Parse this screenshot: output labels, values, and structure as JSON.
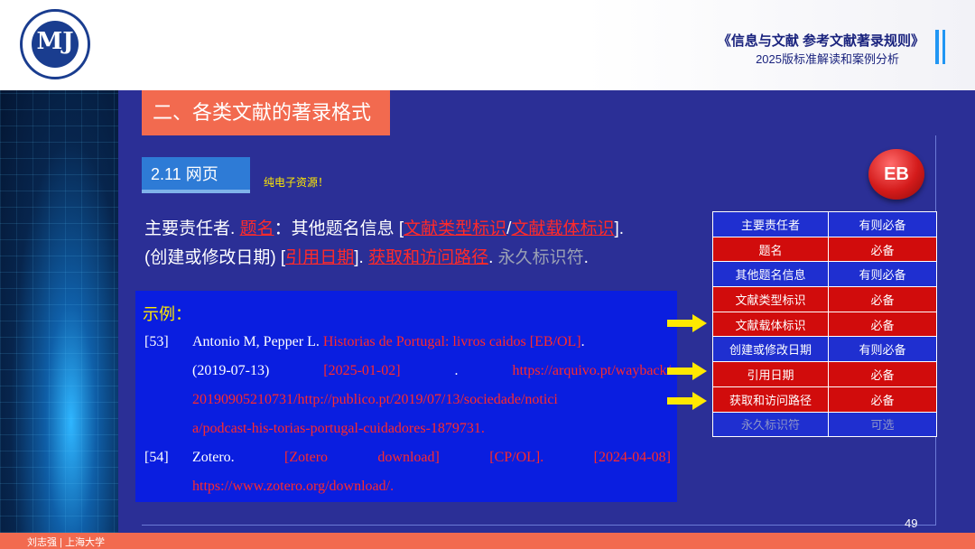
{
  "header": {
    "title": "《信息与文献  参考文献著录规则》",
    "subtitle": "2025版标准解读和案例分析",
    "logo_glyph": "MJ",
    "logo_icon": "university-seal-icon"
  },
  "section": {
    "title": "二、各类文献的著录格式"
  },
  "subsection": {
    "title": "2.11 网页",
    "note": "纯电子资源！",
    "badge": "EB"
  },
  "format": {
    "line1": {
      "s1": "主要责任者.  ",
      "s2": "题名",
      "s3": "：其他题名信息  [",
      "s4": "文献类型标识",
      "s5": "/",
      "s6": "文献载体标识",
      "s7": "]."
    },
    "line2": {
      "s1": "(创建或修改日期) [",
      "s2": "引用日期",
      "s3": "]. ",
      "s4": "获取和访问路径",
      "s5": ". ",
      "s6": "永久标识符",
      "s7": "."
    }
  },
  "example": {
    "title": "示例：",
    "refs": [
      {
        "num": "[53]",
        "l1": {
          "a": "Antonio M, Pepper L. ",
          "b": "Historias de Portugal: livros caidos [EB/OL]",
          "c": "."
        },
        "l2": {
          "a": "(2019-07-13)",
          "b": "[2025-01-02]",
          "c": ".",
          "d": "https://arquivo.pt/wayback/"
        },
        "l3": "20190905210731/http://publico.pt/2019/07/13/sociedade/notici",
        "l4": "a/podcast-his-torias-portugal-cuidadores-1879731."
      },
      {
        "num": "[54]",
        "l1": {
          "a": "Zotero.",
          "b": "[Zotero",
          "c": "download]",
          "d": "[CP/OL].",
          "e": "[2024-04-08]",
          "f": "."
        },
        "l2": "https://www.zotero.org/download/."
      }
    ]
  },
  "requirements_table": {
    "rows": [
      {
        "element": "主要责任者",
        "status": "有则必备"
      },
      {
        "element": "题名",
        "status": "必备"
      },
      {
        "element": "其他题名信息",
        "status": "有则必备"
      },
      {
        "element": "文献类型标识",
        "status": "必备"
      },
      {
        "element": "文献载体标识",
        "status": "必备"
      },
      {
        "element": "创建或修改日期",
        "status": "有则必备"
      },
      {
        "element": "引用日期",
        "status": "必备"
      },
      {
        "element": "获取和访问路径",
        "status": "必备"
      },
      {
        "element": "永久标识符",
        "status": "可选"
      }
    ]
  },
  "colors": {
    "background": "#2b2f96",
    "accent_orange": "#f26a4f",
    "required_red": "#d10c0c",
    "optional_blue": "#1f2fd0",
    "highlight_yellow": "#ffe800"
  },
  "page": {
    "number": "49",
    "footer": "刘志强 | 上海大学"
  }
}
